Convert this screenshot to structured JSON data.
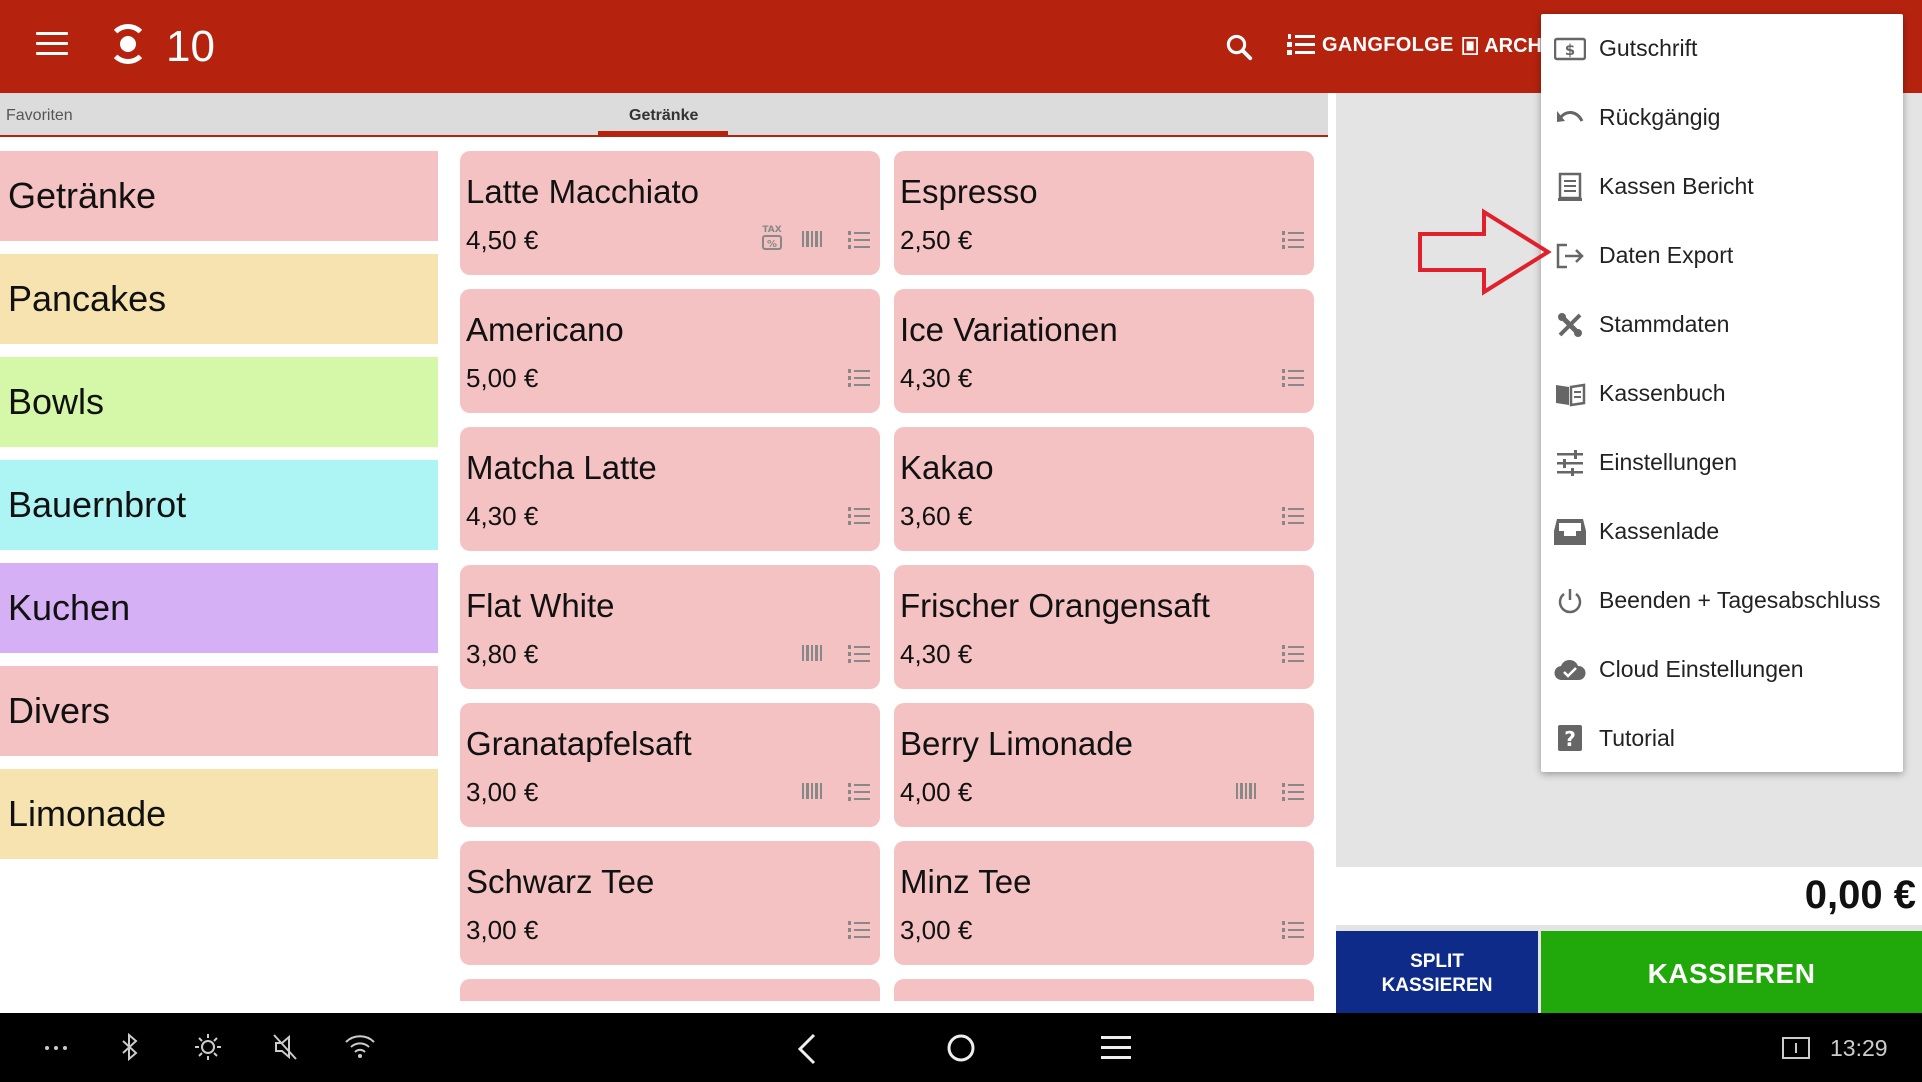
{
  "header": {
    "table_number": "10",
    "gangfolge_label": "GANGFOLGE",
    "archiv_label": "ARCH"
  },
  "tabs": [
    {
      "label": "Favoriten",
      "active": false
    },
    {
      "label": "Getränke",
      "active": true
    }
  ],
  "categories": [
    {
      "label": "Getränke",
      "color": "#f4c2c2"
    },
    {
      "label": "Pancakes",
      "color": "#f7e3b0"
    },
    {
      "label": "Bowls",
      "color": "#d4f7a8"
    },
    {
      "label": "Bauernbrot",
      "color": "#adf4f4"
    },
    {
      "label": "Kuchen",
      "color": "#d5b0f4"
    },
    {
      "label": "Divers",
      "color": "#f4c2c2"
    },
    {
      "label": "Limonade",
      "color": "#f7e3b0"
    }
  ],
  "products": [
    {
      "name": "Latte Macchiato",
      "price": "4,50 €",
      "icons": [
        "tax-icon",
        "barcode-icon",
        "list-icon"
      ]
    },
    {
      "name": "Espresso",
      "price": "2,50 €",
      "icons": [
        "list-icon"
      ]
    },
    {
      "name": "Americano",
      "price": "5,00 €",
      "icons": [
        "list-icon"
      ]
    },
    {
      "name": "Ice Variationen",
      "price": "4,30 €",
      "icons": [
        "list-icon"
      ]
    },
    {
      "name": "Matcha Latte",
      "price": "4,30 €",
      "icons": [
        "list-icon"
      ]
    },
    {
      "name": "Kakao",
      "price": "3,60 €",
      "icons": [
        "list-icon"
      ]
    },
    {
      "name": "Flat White",
      "price": "3,80 €",
      "icons": [
        "barcode-icon",
        "list-icon"
      ]
    },
    {
      "name": "Frischer Orangensaft",
      "price": "4,30 €",
      "icons": [
        "list-icon"
      ]
    },
    {
      "name": "Granatapfelsaft",
      "price": "3,00 €",
      "icons": [
        "barcode-icon",
        "list-icon"
      ]
    },
    {
      "name": "Berry Limonade",
      "price": "4,00 €",
      "icons": [
        "barcode-icon",
        "list-icon"
      ]
    },
    {
      "name": "Schwarz Tee",
      "price": "3,00 €",
      "icons": [
        "list-icon"
      ]
    },
    {
      "name": "Minz Tee",
      "price": "3,00 €",
      "icons": [
        "list-icon"
      ]
    }
  ],
  "cart": {
    "total": "0,00 €",
    "split_label_line1": "SPLIT",
    "split_label_line2": "KASSIEREN",
    "checkout_label": "KASSIEREN"
  },
  "menu": {
    "items": [
      {
        "label": "Gutschrift",
        "icon": "voucher-icon"
      },
      {
        "label": "Rückgängig",
        "icon": "undo-icon"
      },
      {
        "label": "Kassen Bericht",
        "icon": "report-icon"
      },
      {
        "label": "Daten Export",
        "icon": "export-icon"
      },
      {
        "label": "Stammdaten",
        "icon": "tools-icon"
      },
      {
        "label": "Kassenbuch",
        "icon": "book-icon"
      },
      {
        "label": "Einstellungen",
        "icon": "sliders-icon"
      },
      {
        "label": "Kassenlade",
        "icon": "drawer-icon"
      },
      {
        "label": "Beenden + Tagesabschluss",
        "icon": "power-icon"
      },
      {
        "label": "Cloud Einstellungen",
        "icon": "cloud-icon"
      },
      {
        "label": "Tutorial",
        "icon": "help-icon"
      }
    ]
  },
  "system": {
    "clock": "13:29"
  },
  "colors": {
    "header": "#b5230f",
    "split_button": "#0e2b8a",
    "checkout_button": "#21a80a",
    "product_tile": "#f4c2c2",
    "annotation_arrow": "#e0202a"
  }
}
